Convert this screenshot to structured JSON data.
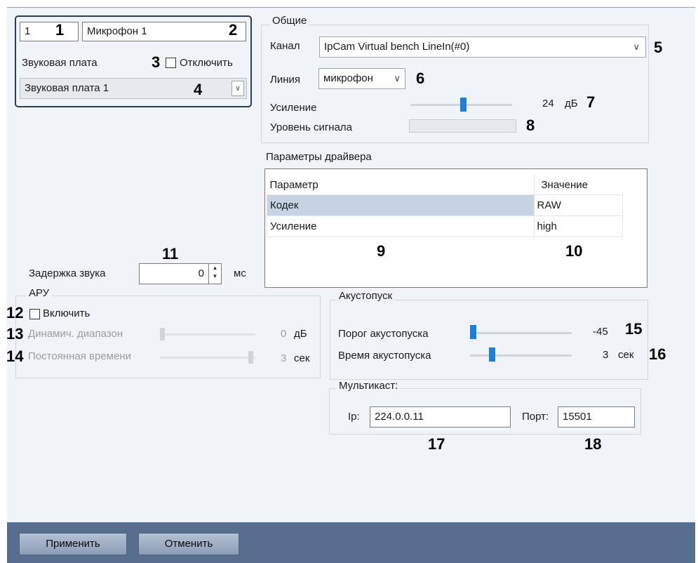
{
  "device": {
    "id": "1",
    "name": "Микрофон 1",
    "soundcard_label": "Звуковая плата",
    "disable_label": "Отключить",
    "soundcard_value": "Звуковая плата 1"
  },
  "general": {
    "title": "Общие",
    "channel_label": "Канал",
    "channel_value": "IpCam Virtual bench  LineIn(#0)",
    "line_label": "Линия",
    "line_value": "микрофон",
    "gain_label": "Усиление",
    "gain_value": "24",
    "gain_unit": "дБ",
    "signal_label": "Уровень сигнала"
  },
  "driver": {
    "title": "Параметры драйвера",
    "columns": [
      "Параметр",
      "Значение"
    ],
    "rows": [
      {
        "param": "Кодек",
        "value": "RAW"
      },
      {
        "param": "Усиление",
        "value": "high"
      }
    ]
  },
  "delay": {
    "label": "Задержка звука",
    "value": "0",
    "unit": "мс"
  },
  "agc": {
    "title": "АРУ",
    "enable_label": "Включить",
    "range_label": "Динамич. диапазон",
    "range_value": "0",
    "range_unit": "дБ",
    "time_label": "Постоянная времени",
    "time_value": "3",
    "time_unit": "сек"
  },
  "vox": {
    "title": "Акустопуск",
    "threshold_label": "Порог акустопуска",
    "threshold_value": "-45",
    "time_label": "Время акустопуска",
    "time_value": "3",
    "time_unit": "сек"
  },
  "multicast": {
    "title": "Мультикаст:",
    "ip_label": "Ip:",
    "ip_value": "224.0.0.11",
    "port_label": "Порт:",
    "port_value": "15501"
  },
  "buttons": {
    "apply": "Применить",
    "cancel": "Отменить"
  },
  "callouts": [
    "1",
    "2",
    "3",
    "4",
    "5",
    "6",
    "7",
    "8",
    "9",
    "10",
    "11",
    "12",
    "13",
    "14",
    "15",
    "16",
    "17",
    "18"
  ],
  "colors": {
    "slider_thumb": "#1d7fd6",
    "bottom_bar": "#586e8e",
    "selected_row": "#c5d3e2"
  }
}
